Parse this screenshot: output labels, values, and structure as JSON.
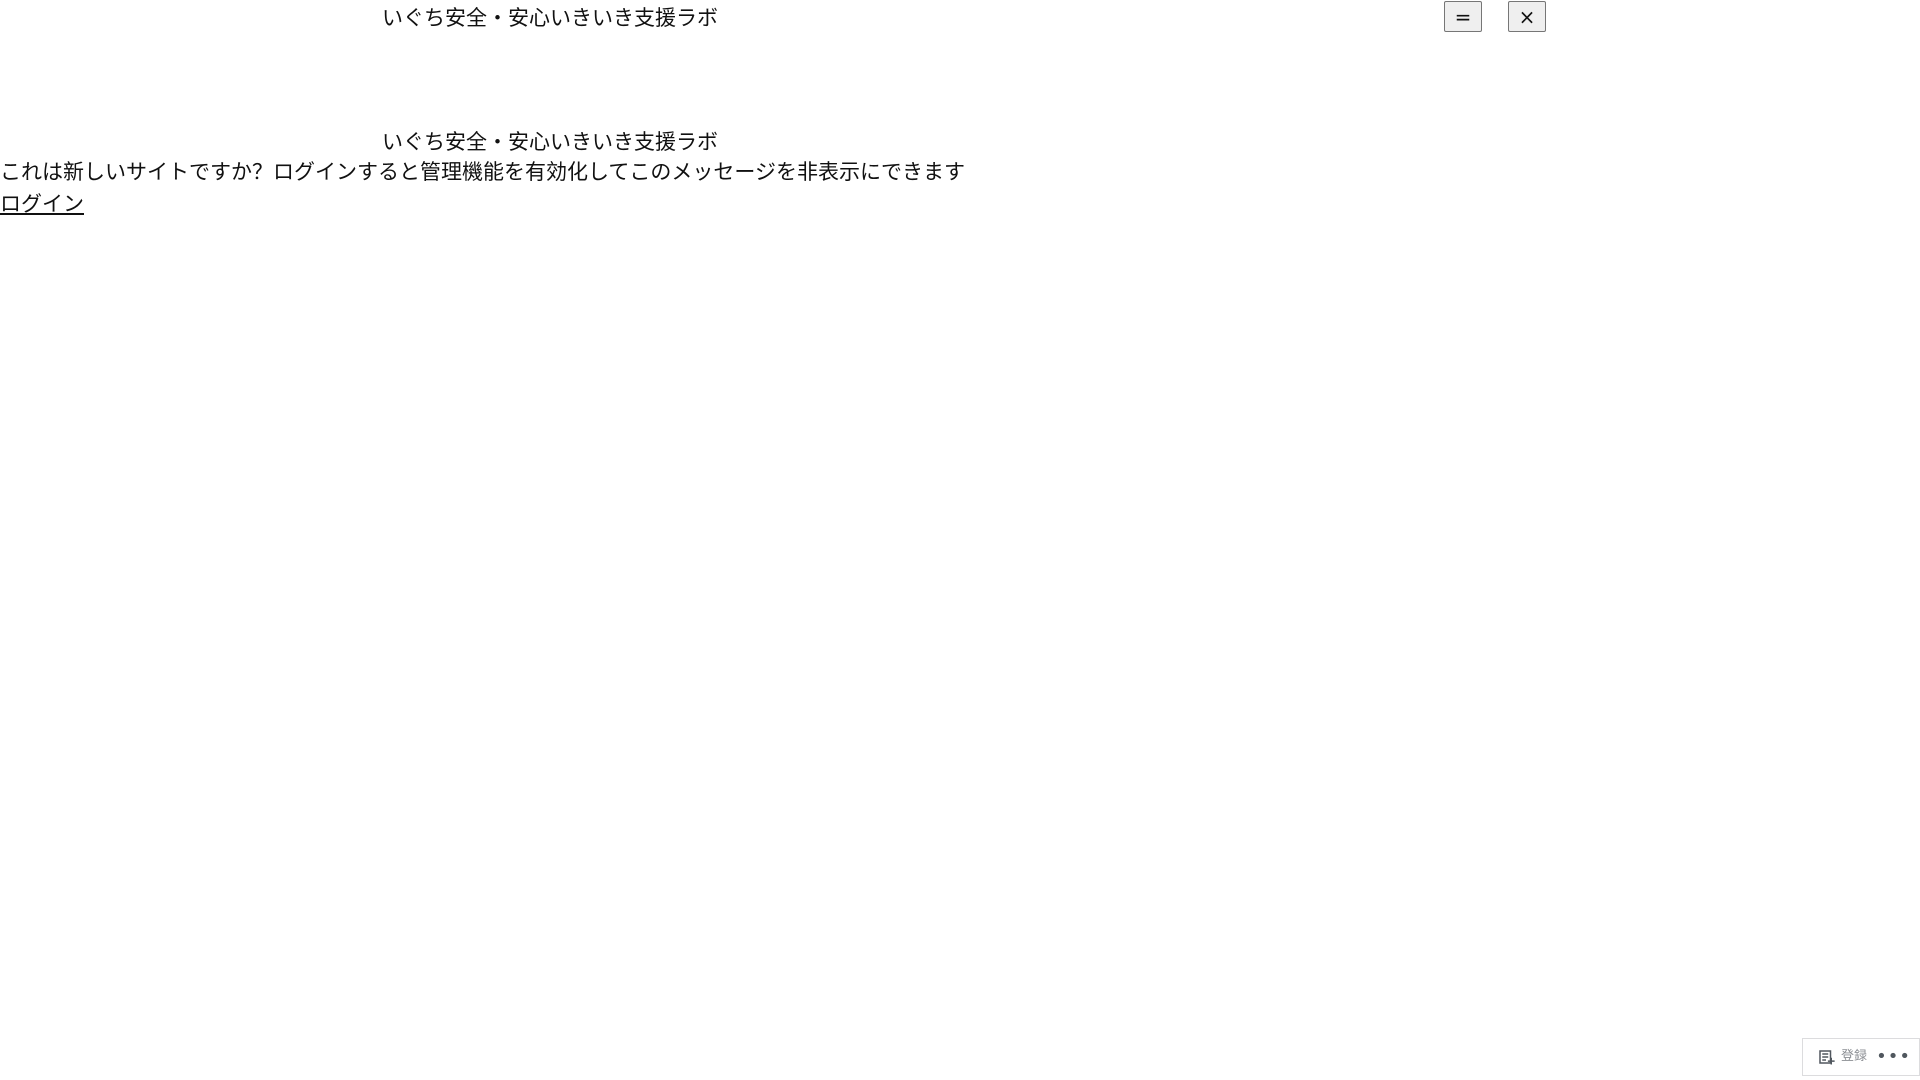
{
  "header": {
    "title": "いぐち安全・安心いきいき支援ラボ",
    "menu_button_label": "=",
    "close_button_label": "×"
  },
  "main": {
    "site_title": "いぐち安全・安心いきいき支援ラボ",
    "message": "これは新しいサイトですか？ログインすると管理機能を有効化してこのメッセージを非表示にできます",
    "login_link": "ログイン"
  },
  "footer": {
    "subscribe_label": "登録",
    "more_label": "•••"
  },
  "icons": {
    "subscribe": "subscribe-icon",
    "more": "more-icon"
  }
}
